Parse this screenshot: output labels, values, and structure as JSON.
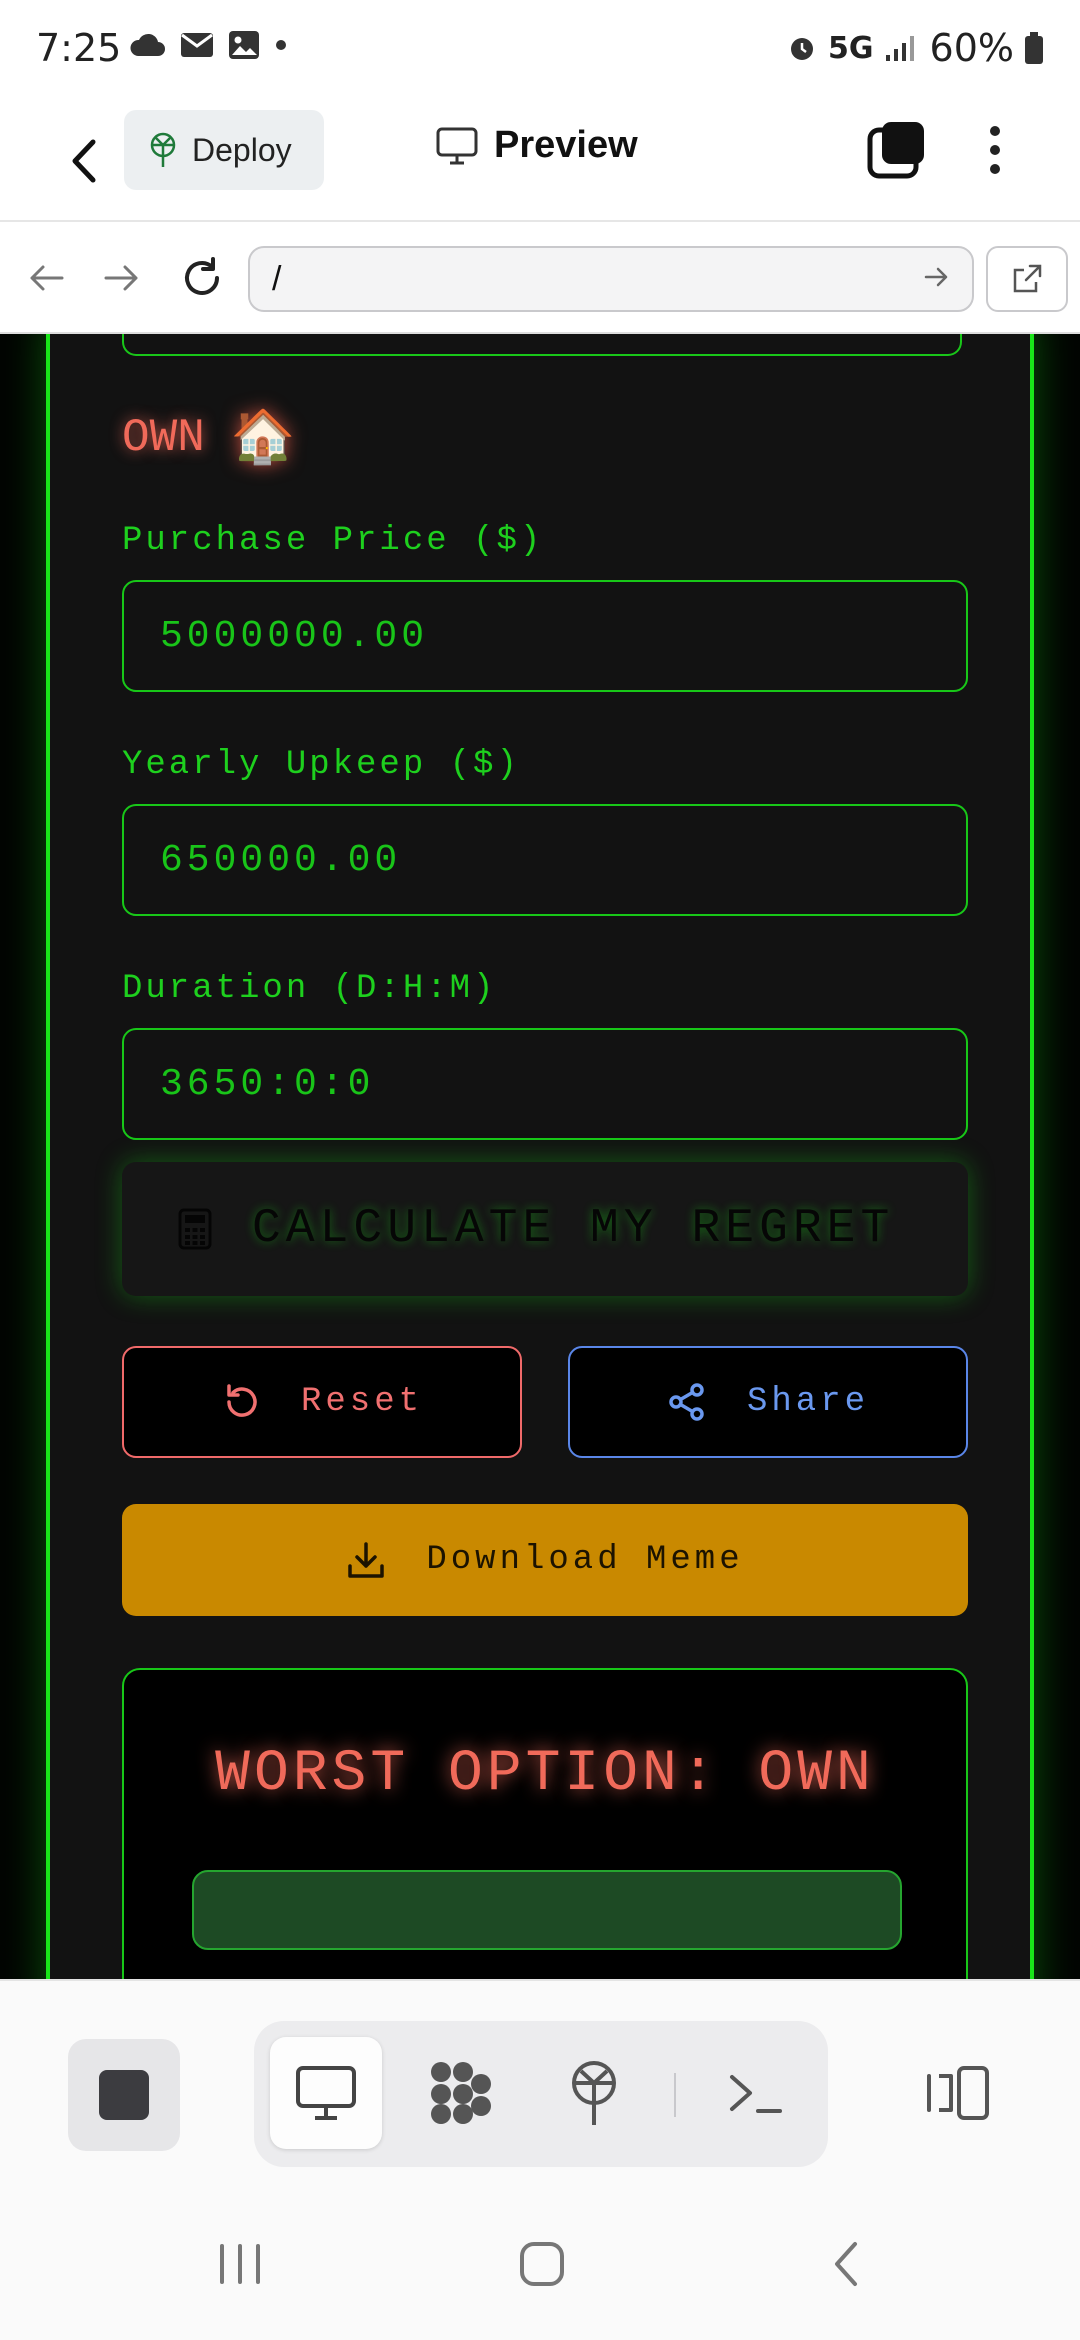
{
  "status_bar": {
    "time": "7:25",
    "network": "5G",
    "battery": "60%"
  },
  "toolbar": {
    "deploy_label": "Deploy",
    "preview_label": "Preview"
  },
  "browser": {
    "url": "/"
  },
  "form": {
    "section_title": "OWN",
    "section_emoji": "🏠",
    "purchase_price_label": "Purchase Price ($)",
    "purchase_price_value": "5000000.00",
    "yearly_upkeep_label": "Yearly Upkeep ($)",
    "yearly_upkeep_value": "650000.00",
    "duration_label": "Duration (D:H:M)",
    "duration_value": "3650:0:0"
  },
  "actions": {
    "calculate_label": "CALCULATE MY REGRET",
    "reset_label": "Reset",
    "share_label": "Share",
    "download_label": "Download Meme"
  },
  "result": {
    "title": "WORST OPTION: OWN"
  },
  "colors": {
    "neon_green": "#19e619",
    "accent_red": "#f06a5a",
    "accent_blue": "#6a98ef",
    "download_gold": "#c98900"
  }
}
